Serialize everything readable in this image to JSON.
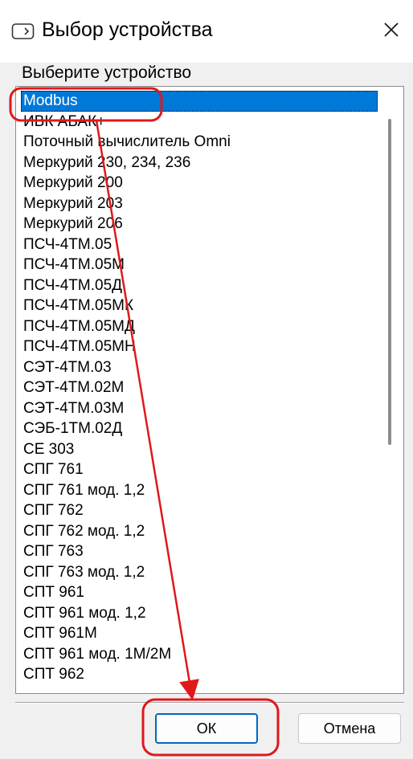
{
  "window": {
    "title": "Выбор устройства",
    "close_label": "✕"
  },
  "prompt": "Выберите устройство",
  "devices": {
    "selected_index": 0,
    "items": [
      "Modbus",
      "ИВК АБАК+",
      "Поточный вычислитель Omni",
      "Меркурий 230, 234, 236",
      "Меркурий 200",
      "Меркурий 203",
      "Меркурий 206",
      "ПСЧ-4ТМ.05",
      "ПСЧ-4ТМ.05М",
      "ПСЧ-4ТМ.05Д",
      "ПСЧ-4ТМ.05МК",
      "ПСЧ-4ТМ.05МД",
      "ПСЧ-4ТМ.05МН",
      "СЭТ-4ТМ.03",
      "СЭТ-4ТМ.02М",
      "СЭТ-4ТМ.03М",
      "СЭБ-1ТМ.02Д",
      "CE 303",
      "СПГ 761",
      "СПГ 761 мод. 1,2",
      "СПГ 762",
      "СПГ 762 мод. 1,2",
      "СПГ 763",
      "СПГ 763 мод. 1,2",
      "СПТ 961",
      "СПТ 961 мод. 1,2",
      "СПТ 961М",
      "СПТ 961 мод. 1М/2М",
      "СПТ 962"
    ]
  },
  "buttons": {
    "ok": "ОК",
    "cancel": "Отмена"
  },
  "colors": {
    "selection": "#0078d7",
    "annotation": "#e0181b",
    "accent_border": "#0067c0"
  }
}
